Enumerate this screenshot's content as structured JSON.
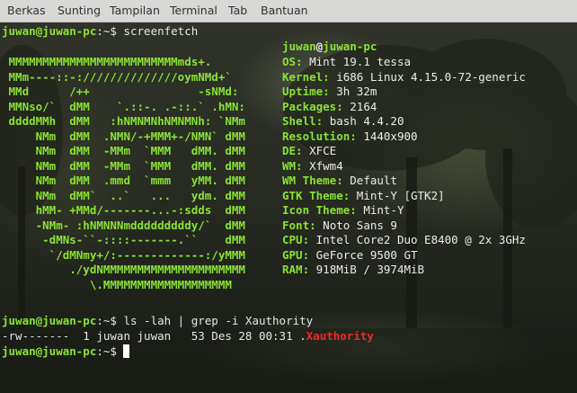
{
  "menubar": {
    "items": [
      "Berkas",
      "Sunting",
      "Tampilan",
      "Terminal",
      "Tab",
      "Bantuan"
    ]
  },
  "terminal": {
    "prompt": {
      "user_host": "juwan@juwan-pc",
      "path": ":~$ "
    },
    "commands": {
      "first": "screenfetch",
      "second": "ls -lah | grep -i Xauthority"
    },
    "ls_output": {
      "prefix": "-rw-------  1 juwan juwan   53 Des 28 00:31 .",
      "highlight": "Xauthority"
    },
    "screenfetch": {
      "header": {
        "user": "juwan",
        "at": "@",
        "host": "juwan-pc"
      },
      "logo": [
        "",
        " MMMMMMMMMMMMMMMMMMMMMMMMMmds+.",
        " MMm----::-://////////////oymNMd+`",
        " MMd      /++                -sNMd:",
        " MMNso/`  dMM    `.::-. .-::.` .hMN:",
        " ddddMMh  dMM   :hNMNMNhNMNMNh: `NMm",
        "     NMm  dMM  .NMN/-+MMM+-/NMN` dMM",
        "     NMm  dMM  -MMm  `MMM   dMM. dMM",
        "     NMm  dMM  -MMm  `MMM   dMM. dMM",
        "     NMm  dMM  .mmd  `mmm   yMM. dMM",
        "     NMm  dMM`  ..`   ...   ydm. dMM",
        "     hMM- +MMd/-------...-:sdds  dMM",
        "     -NMm- :hNMNNNmdddddddddy/`  dMM",
        "      -dMNs-``-::::-------.``    dMM",
        "       `/dMNmy+/:-------------:/yMMM",
        "          ./ydNMMMMMMMMMMMMMMMMMMMMM",
        "             \\.MMMMMMMMMMMMMMMMMMM"
      ],
      "info": [
        {
          "key": "OS:",
          "value": "Mint 19.1 tessa"
        },
        {
          "key": "Kernel:",
          "value": "i686 Linux 4.15.0-72-generic"
        },
        {
          "key": "Uptime:",
          "value": "3h 32m"
        },
        {
          "key": "Packages:",
          "value": "2164"
        },
        {
          "key": "Shell:",
          "value": "bash 4.4.20"
        },
        {
          "key": "Resolution:",
          "value": "1440x900"
        },
        {
          "key": "DE:",
          "value": "XFCE"
        },
        {
          "key": "WM:",
          "value": "Xfwm4"
        },
        {
          "key": "WM Theme:",
          "value": "Default"
        },
        {
          "key": "GTK Theme:",
          "value": "Mint-Y [GTK2]"
        },
        {
          "key": "Icon Theme:",
          "value": "Mint-Y"
        },
        {
          "key": "Font:",
          "value": "Noto Sans 9"
        },
        {
          "key": "CPU:",
          "value": "Intel Core2 Duo E8400 @ 2x 3GHz"
        },
        {
          "key": "GPU:",
          "value": "GeForce 9500 GT"
        },
        {
          "key": "RAM:",
          "value": "918MiB / 3974MiB"
        }
      ]
    },
    "colors": {
      "prompt": "#8ae234",
      "text": "#ececec",
      "highlight": "#ef2929",
      "menubar": "#d8d8d6"
    }
  }
}
